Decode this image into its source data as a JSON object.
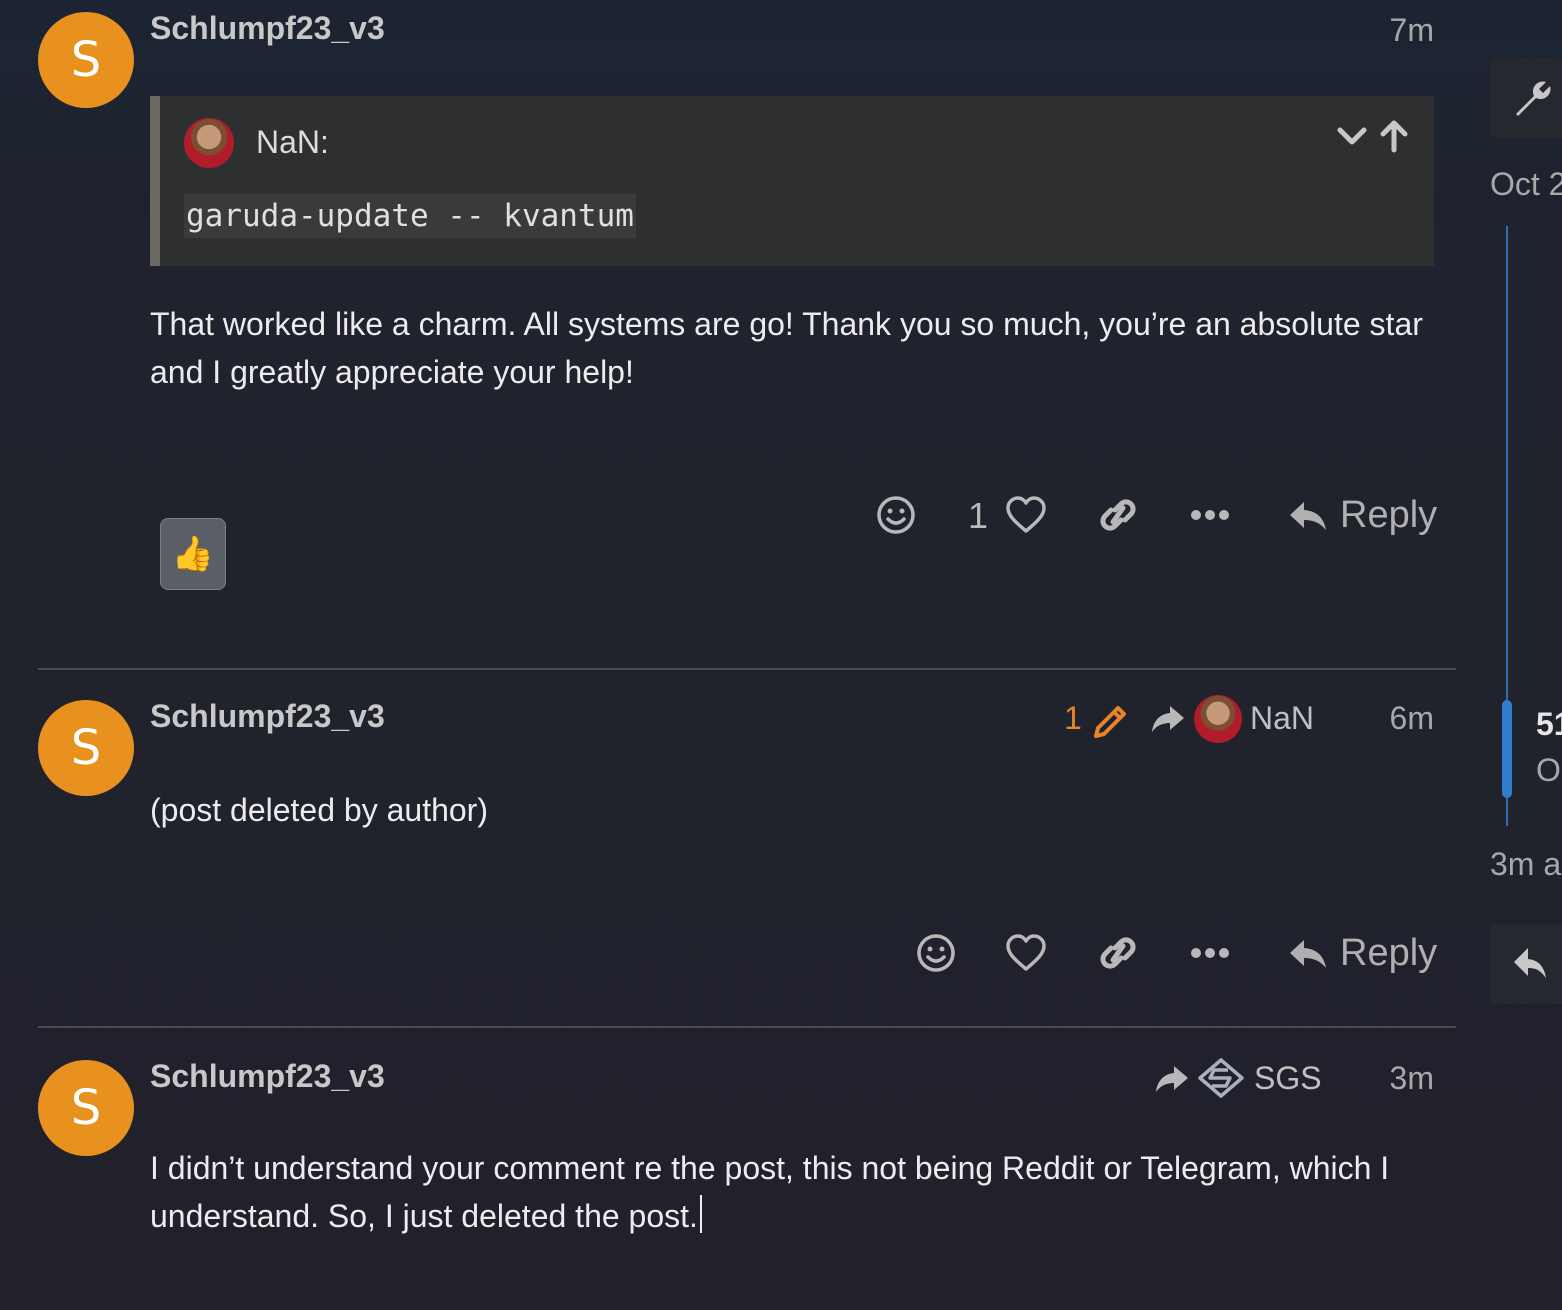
{
  "posts": [
    {
      "avatar_letter": "S",
      "username": "Schlumpf23_v3",
      "time": "7m",
      "quote": {
        "user": "NaN:",
        "code": "garuda-update -- kvantum"
      },
      "body": "That worked like a charm. All systems are go! Thank you so much, you’re an absolute star and I greatly appreciate your help!",
      "like_count": "1",
      "reply_label": "Reply",
      "reaction": "👍"
    },
    {
      "avatar_letter": "S",
      "username": "Schlumpf23_v3",
      "edit_count": "1",
      "reply_to": "NaN",
      "time": "6m",
      "body": "(post deleted by author)",
      "reply_label": "Reply"
    },
    {
      "avatar_letter": "S",
      "username": "Schlumpf23_v3",
      "reply_to": "SGS",
      "time": "3m",
      "body": "I didn’t understand your comment re the post, this not being Reddit or Telegram, which I understand. So, I just deleted the post."
    }
  ],
  "timeline": {
    "top_date": "Oct 2",
    "position_number": "51",
    "position_date": "Oc",
    "bottom_ago": "3m a"
  },
  "colors": {
    "accent_orange": "#e8842a",
    "avatar_orange": "#e8911f",
    "timeline_blue": "#2f7fce"
  }
}
